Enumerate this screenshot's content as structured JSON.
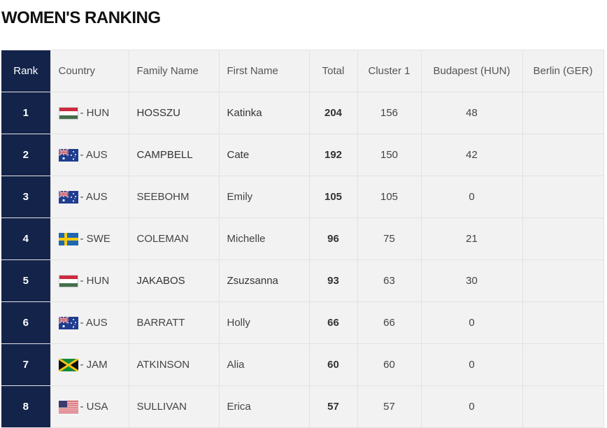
{
  "title": "WOMEN'S RANKING",
  "headers": {
    "rank": "Rank",
    "country": "Country",
    "family": "Family Name",
    "first": "First Name",
    "total": "Total",
    "cluster": "Cluster 1",
    "budapest": "Budapest (HUN)",
    "berlin": "Berlin (GER)"
  },
  "rows": [
    {
      "rank": "1",
      "flag": "hun-flag-icon",
      "country": "- HUN",
      "family": "HOSSZU",
      "first": "Katinka",
      "total": "204",
      "cluster": "156",
      "budapest": "48",
      "berlin": ""
    },
    {
      "rank": "2",
      "flag": "aus-flag-icon",
      "country": "- AUS",
      "family": "CAMPBELL",
      "first": "Cate",
      "total": "192",
      "cluster": "150",
      "budapest": "42",
      "berlin": ""
    },
    {
      "rank": "3",
      "flag": "aus-flag-icon",
      "country": "- AUS",
      "family": "SEEBOHM",
      "first": "Emily",
      "total": "105",
      "cluster": "105",
      "budapest": "0",
      "berlin": ""
    },
    {
      "rank": "4",
      "flag": "swe-flag-icon",
      "country": "- SWE",
      "family": "COLEMAN",
      "first": "Michelle",
      "total": "96",
      "cluster": "75",
      "budapest": "21",
      "berlin": ""
    },
    {
      "rank": "5",
      "flag": "hun-flag-icon",
      "country": "- HUN",
      "family": "JAKABOS",
      "first": "Zsuzsanna",
      "total": "93",
      "cluster": "63",
      "budapest": "30",
      "berlin": ""
    },
    {
      "rank": "6",
      "flag": "aus-flag-icon",
      "country": "- AUS",
      "family": "BARRATT",
      "first": "Holly",
      "total": "66",
      "cluster": "66",
      "budapest": "0",
      "berlin": ""
    },
    {
      "rank": "7",
      "flag": "jam-flag-icon",
      "country": "- JAM",
      "family": "ATKINSON",
      "first": "Alia",
      "total": "60",
      "cluster": "60",
      "budapest": "0",
      "berlin": ""
    },
    {
      "rank": "8",
      "flag": "usa-flag-icon",
      "country": "- USA",
      "family": "SULLIVAN",
      "first": "Erica",
      "total": "57",
      "cluster": "57",
      "budapest": "0",
      "berlin": ""
    }
  ],
  "colors": {
    "rank_column": "#13234a",
    "row_background": "#f2f2f2",
    "border": "#e2e2e2"
  }
}
